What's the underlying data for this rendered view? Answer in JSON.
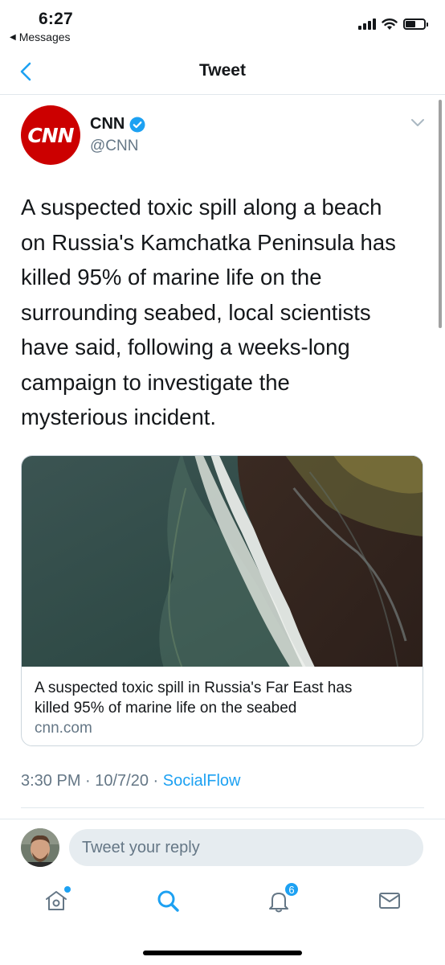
{
  "status_bar": {
    "time": "6:27",
    "back_app": "Messages"
  },
  "nav": {
    "title": "Tweet"
  },
  "tweet": {
    "author_name": "CNN",
    "author_handle": "@CNN",
    "avatar_text": "CNN",
    "text_lines": [
      "A suspected toxic spill along a beach",
      "on Russia's Kamchatka Peninsula has",
      "killed 95% of marine life on the",
      "surrounding seabed, local scientists",
      "have said, following a weeks-long",
      "campaign to investigate the",
      "mysterious incident."
    ],
    "card": {
      "title_line1": "A suspected toxic spill in Russia's Far East has",
      "title_line2": "killed 95% of marine life on the seabed",
      "domain": "cnn.com"
    },
    "timestamp": "3:30 PM · 10/7/20 · ",
    "source": "SocialFlow"
  },
  "reply": {
    "placeholder": "Tweet your reply"
  },
  "tabs": {
    "notifications_count": "6"
  },
  "colors": {
    "accent": "#1da1f2",
    "text": "#14171a",
    "muted": "#657786",
    "brand_red": "#cc0000"
  }
}
